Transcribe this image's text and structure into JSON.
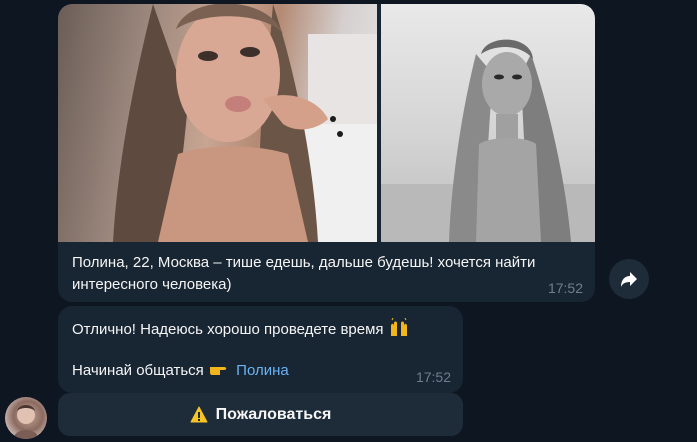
{
  "album": {
    "caption": "Полина, 22, Москва – тише едешь, дальше будешь! хочется найти интересного человека)",
    "time": "17:52",
    "photos": [
      {
        "icon": "photo-color-portrait"
      },
      {
        "icon": "photo-bw-portrait"
      }
    ]
  },
  "message2": {
    "line1": "Отлично! Надеюсь хорошо проведете время",
    "line1_emoji": "raising-hands-icon",
    "line2_prefix": "Начинай общаться",
    "line2_emoji": "pointing-hand-icon",
    "line2_link": "Полина",
    "time": "17:52"
  },
  "report_button": {
    "label": "Пожаловаться",
    "icon": "warning-icon"
  },
  "share_button": {
    "icon": "share-arrow-icon"
  },
  "avatar": {
    "icon": "user-avatar"
  }
}
